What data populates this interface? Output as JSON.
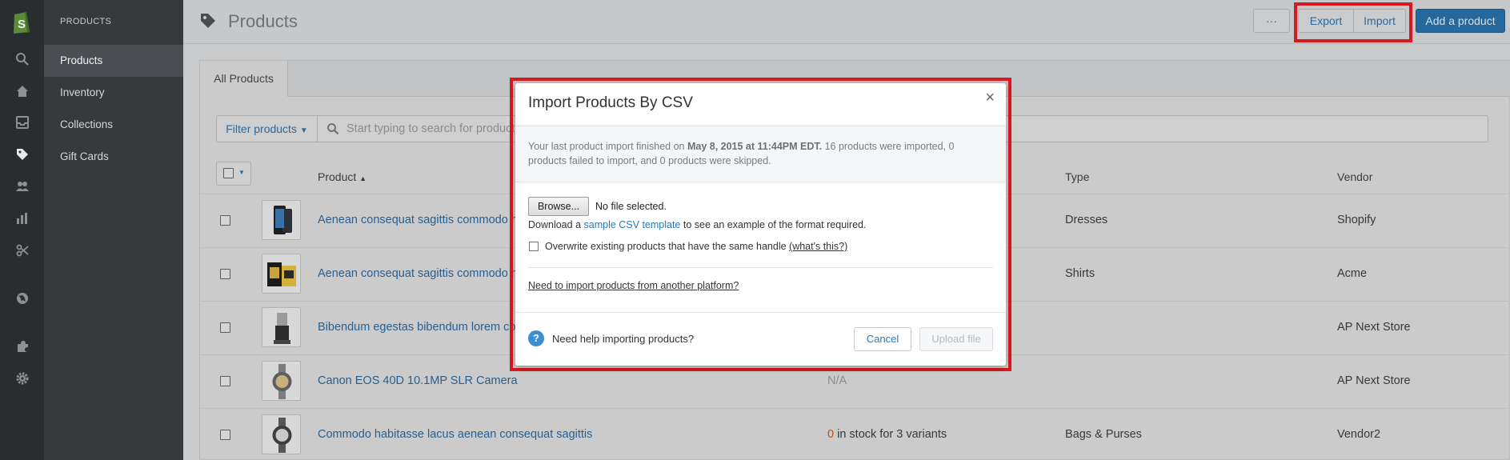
{
  "section_label": "PRODUCTS",
  "nav": {
    "items": [
      {
        "label": "Products",
        "active": true
      },
      {
        "label": "Inventory",
        "active": false
      },
      {
        "label": "Collections",
        "active": false
      },
      {
        "label": "Gift Cards",
        "active": false
      }
    ]
  },
  "rail": {
    "icons": [
      "shopify-logo-icon",
      "search-icon",
      "home-icon",
      "orders-icon",
      "products-tag-icon",
      "customers-icon",
      "reports-icon",
      "discounts-icon",
      "online-store-icon",
      "apps-icon",
      "settings-icon"
    ]
  },
  "header": {
    "title": "Products",
    "more_label": "···",
    "export_label": "Export",
    "import_label": "Import",
    "add_label": "Add a product"
  },
  "tabs": [
    {
      "label": "All Products"
    }
  ],
  "filter": {
    "button_label": "Filter products",
    "search_placeholder": "Start typing to search for products"
  },
  "table": {
    "columns": {
      "product": "Product",
      "type": "Type",
      "vendor": "Vendor"
    },
    "rows": [
      {
        "name": "Aenean consequat sagittis commodo habitasse",
        "inventory": "",
        "type": "Dresses",
        "vendor": "Shopify"
      },
      {
        "name": "Aenean consequat sagittis commodo habitasse",
        "inventory": "",
        "type": "Shirts",
        "vendor": "Acme"
      },
      {
        "name": "Bibendum egestas bibendum lorem commodo",
        "inventory": "",
        "type": "",
        "vendor": "AP Next Store"
      },
      {
        "name": "Canon EOS 40D 10.1MP SLR Camera",
        "inventory": "N/A",
        "type": "",
        "vendor": "AP Next Store"
      },
      {
        "name": "Commodo habitasse lacus aenean consequat sagittis",
        "inventory_count": "0",
        "inventory_rest": " in stock for 3 variants",
        "type": "Bags & Purses",
        "vendor": "Vendor2"
      }
    ]
  },
  "modal": {
    "title": "Import Products By CSV",
    "close": "×",
    "info_prefix": "Your last product import finished on ",
    "info_date": "May 8, 2015 at 11:44PM EDT.",
    "info_rest": " 16 products were imported, 0 products failed to import, and 0 products were skipped.",
    "browse_label": "Browse...",
    "no_file": "No file selected.",
    "download_prefix": "Download a ",
    "download_link": "sample CSV template",
    "download_suffix": " to see an example of the format required.",
    "overwrite_label": "Overwrite existing products that have the same handle ",
    "whats_this": "(what's this?)",
    "other_platform": "Need to import products from another platform?",
    "help_text": "Need help importing products?",
    "cancel_label": "Cancel",
    "upload_label": "Upload file"
  },
  "colors": {
    "highlight": "#d81921",
    "accent": "#2a7ab8",
    "primary_button": "#27689c"
  }
}
